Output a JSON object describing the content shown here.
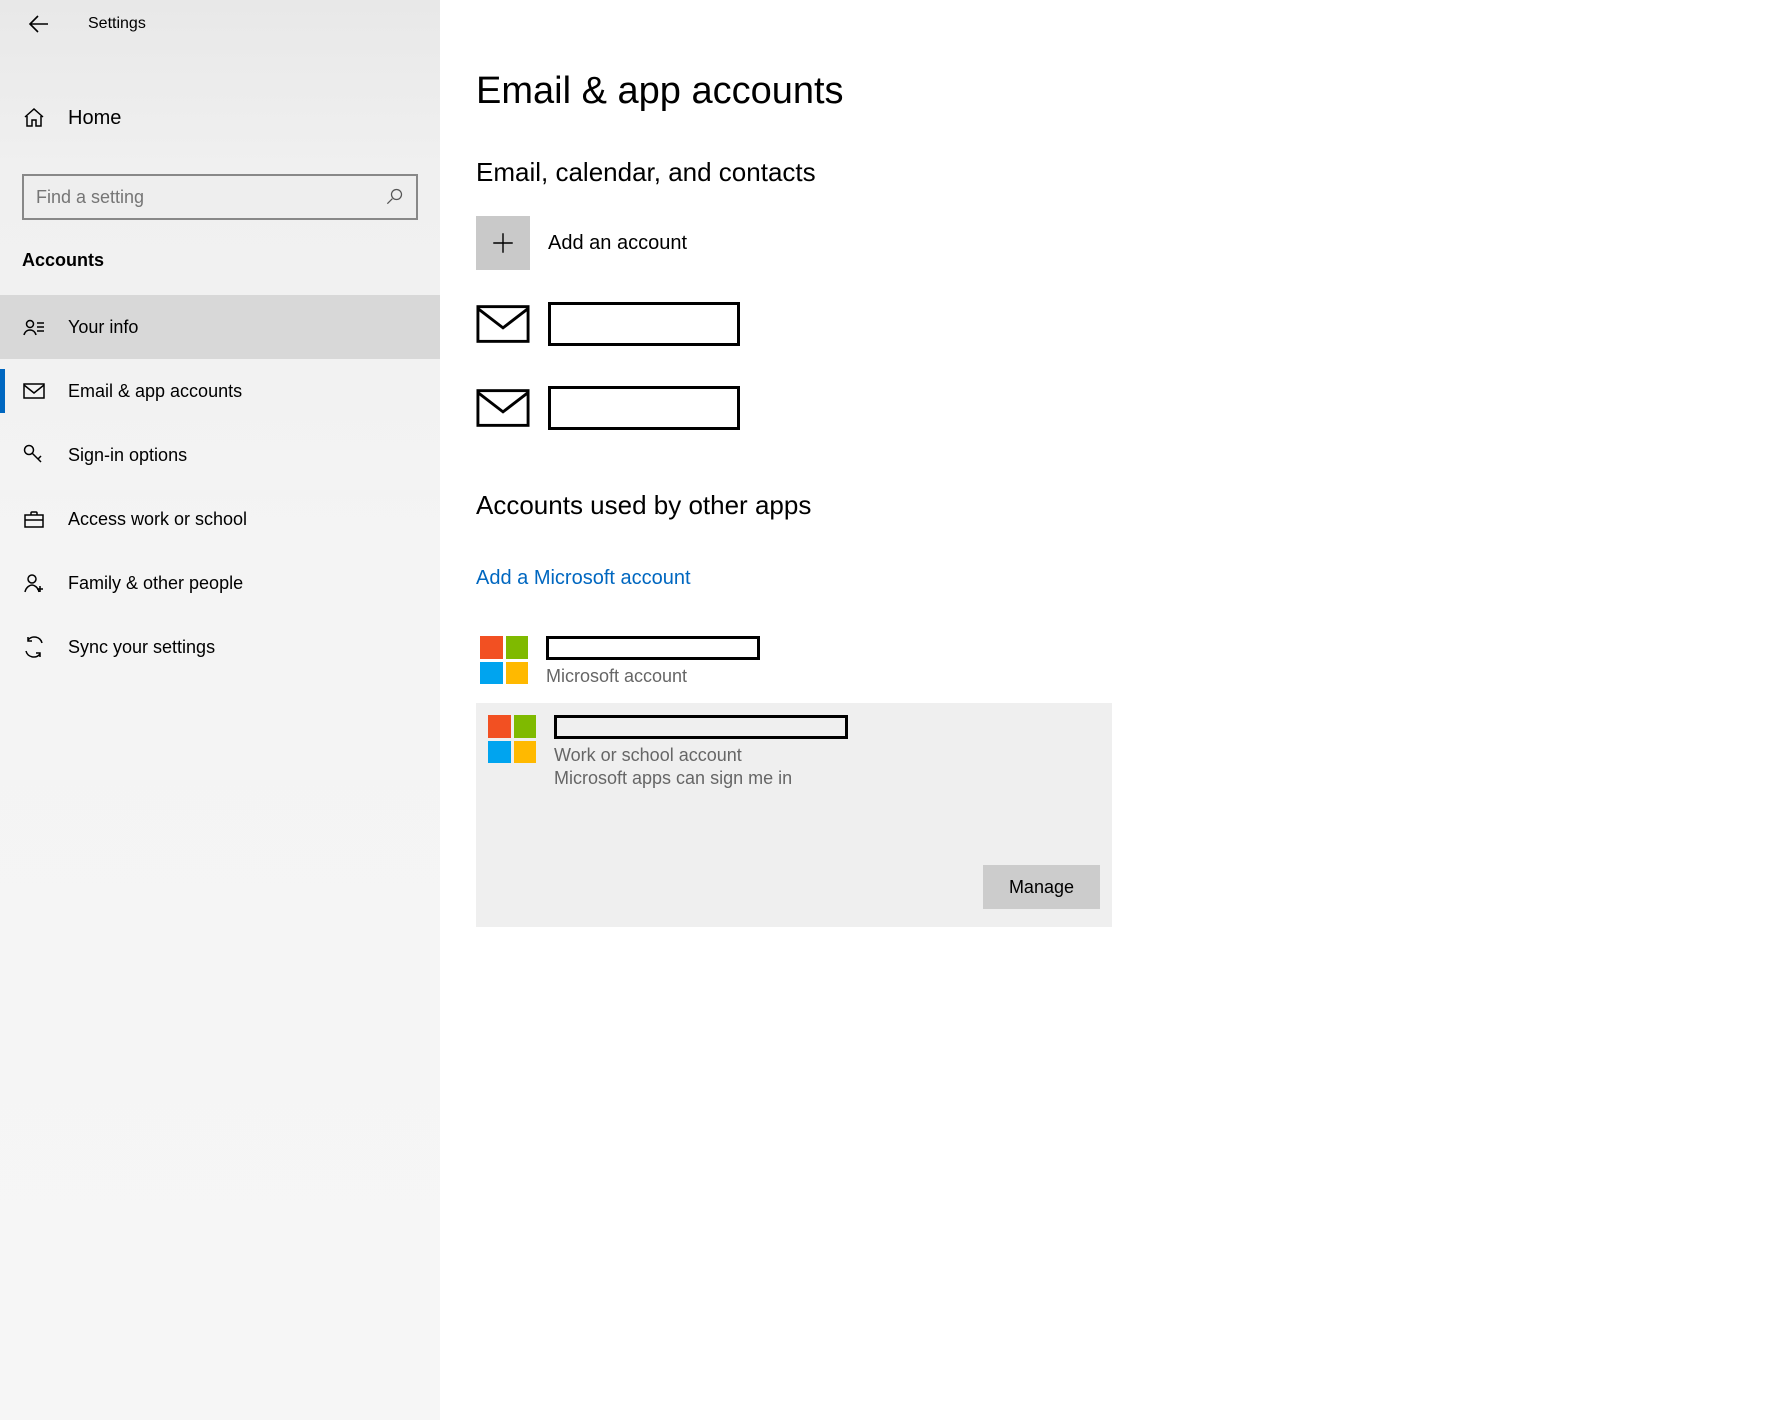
{
  "header": {
    "title": "Settings"
  },
  "sidebar": {
    "home_label": "Home",
    "search_placeholder": "Find a setting",
    "section_label": "Accounts",
    "items": [
      {
        "label": "Your info"
      },
      {
        "label": "Email & app accounts"
      },
      {
        "label": "Sign-in options"
      },
      {
        "label": "Access work or school"
      },
      {
        "label": "Family & other people"
      },
      {
        "label": "Sync your settings"
      }
    ]
  },
  "main": {
    "page_title": "Email & app accounts",
    "section1_title": "Email, calendar, and contacts",
    "add_account_label": "Add an account",
    "section2_title": "Accounts used by other apps",
    "add_ms_link": "Add a Microsoft account",
    "accounts": [
      {
        "type_label": "Microsoft account"
      },
      {
        "type_label": "Work or school account",
        "detail": "Microsoft apps can sign me in"
      }
    ],
    "manage_label": "Manage"
  }
}
